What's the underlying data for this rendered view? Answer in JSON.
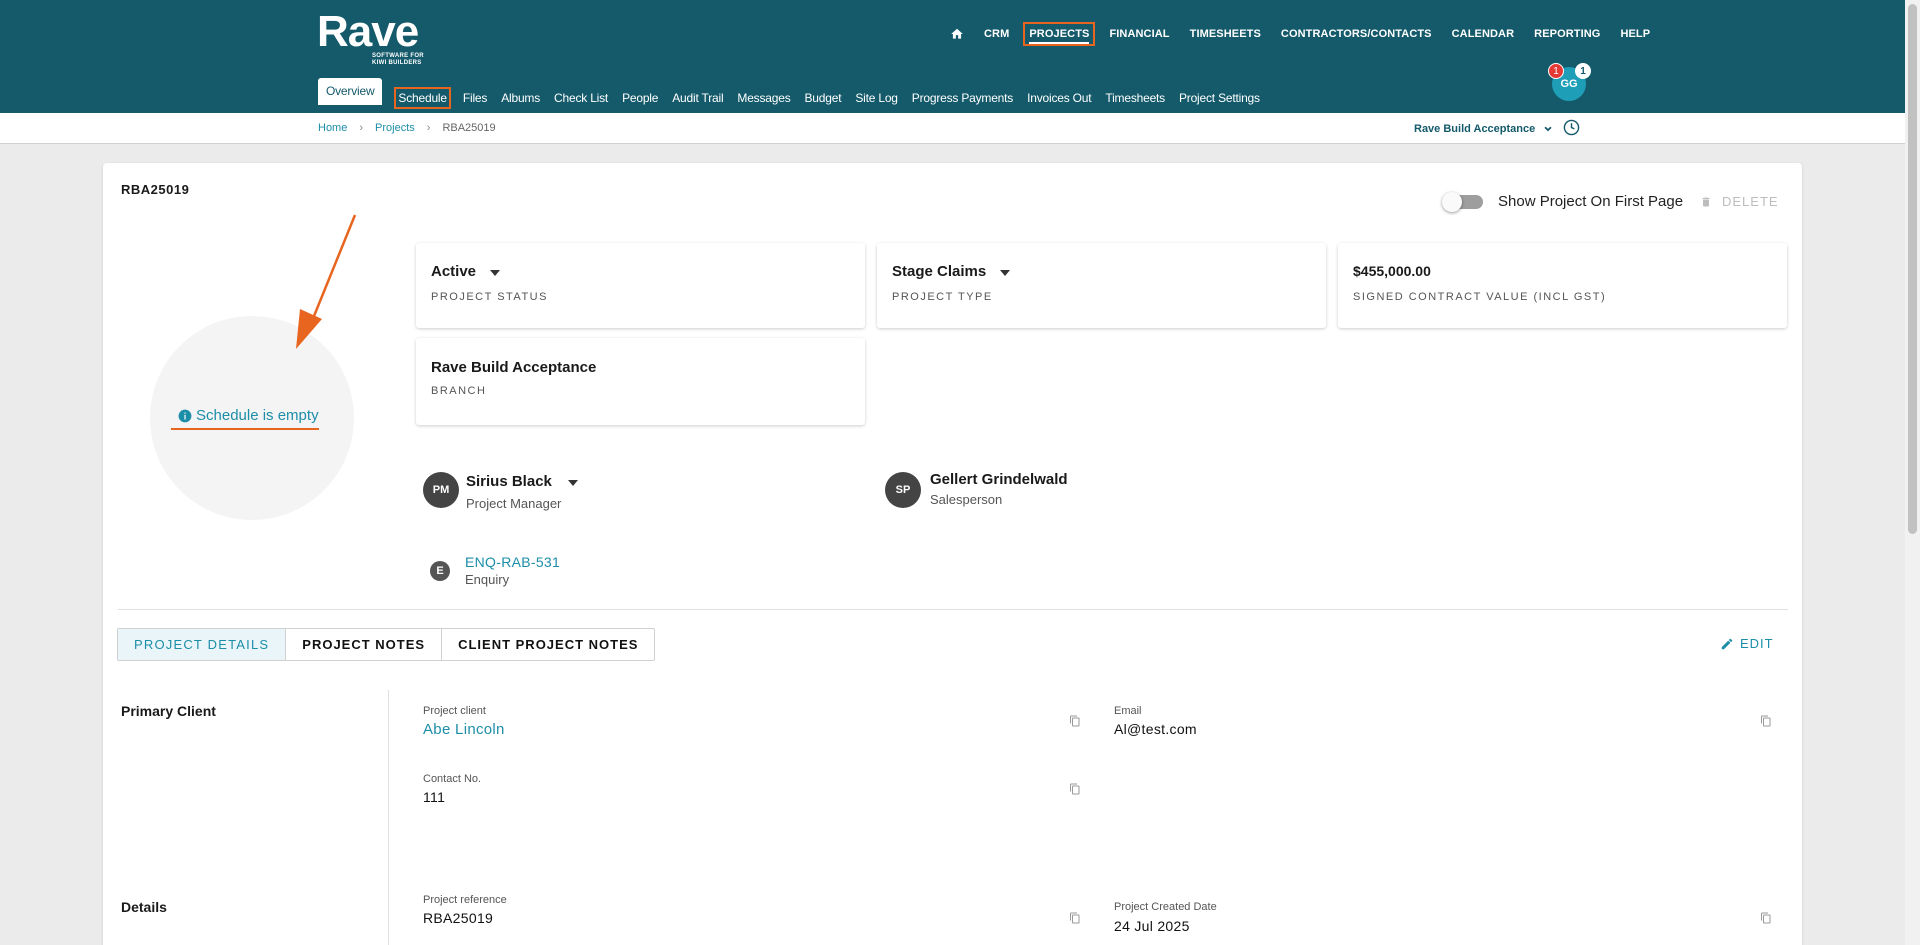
{
  "header": {
    "logo_word": "Rave",
    "logo_tagline": "SOFTWARE FOR KIWI BUILDERS",
    "main_nav": [
      "CRM",
      "PROJECTS",
      "FINANCIAL",
      "TIMESHEETS",
      "CONTRACTORS/CONTACTS",
      "CALENDAR",
      "REPORTING",
      "HELP"
    ],
    "sub_nav": [
      "Overview",
      "Schedule",
      "Files",
      "Albums",
      "Check List",
      "People",
      "Audit Trail",
      "Messages",
      "Budget",
      "Site Log",
      "Progress Payments",
      "Invoices Out",
      "Timesheets",
      "Project Settings"
    ],
    "user_initials": "GG",
    "badge_red": "1",
    "badge_white": "1"
  },
  "breadcrumb": {
    "home": "Home",
    "projects": "Projects",
    "current": "RBA25019",
    "branch": "Rave Build Acceptance"
  },
  "project": {
    "code": "RBA25019",
    "show_first_page_label": "Show Project On First Page",
    "delete_label": "DELETE",
    "schedule_empty": "Schedule is empty",
    "status": {
      "value": "Active",
      "label": "PROJECT STATUS"
    },
    "type": {
      "value": "Stage Claims",
      "label": "PROJECT TYPE"
    },
    "contract": {
      "value": "$455,000.00",
      "label": "SIGNED CONTRACT VALUE (INCL GST)"
    },
    "branch": {
      "value": "Rave Build Acceptance",
      "label": "BRANCH"
    },
    "manager": {
      "initials": "PM",
      "name": "Sirius Black",
      "role": "Project Manager"
    },
    "salesperson": {
      "initials": "SP",
      "name": "Gellert Grindelwald",
      "role": "Salesperson"
    },
    "enquiry": {
      "initial": "E",
      "code": "ENQ-RAB-531",
      "label": "Enquiry"
    }
  },
  "tabs": [
    "PROJECT DETAILS",
    "PROJECT NOTES",
    "CLIENT PROJECT NOTES"
  ],
  "edit_label": "EDIT",
  "details": {
    "primary_client_title": "Primary Client",
    "details_title": "Details",
    "project_client_label": "Project client",
    "project_client_value": "Abe Lincoln",
    "email_label": "Email",
    "email_value": "Al@test.com",
    "contact_label": "Contact No.",
    "contact_value": "111",
    "reference_label": "Project reference",
    "reference_value": "RBA25019",
    "created_label": "Project Created Date",
    "created_value": "24 Jul 2025"
  },
  "colors": {
    "header": "#145a6b",
    "accent": "#1d8ea8",
    "highlight": "#e8651f"
  }
}
